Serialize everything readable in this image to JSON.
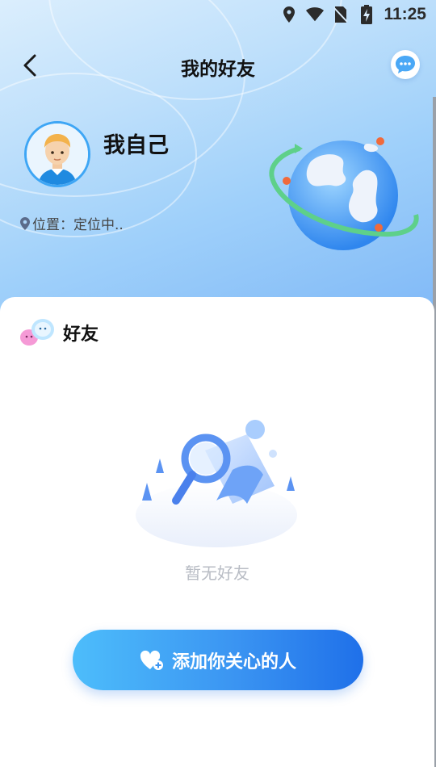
{
  "status_bar": {
    "time": "11:25",
    "icons": [
      "location-icon",
      "wifi-icon",
      "no-sim-icon",
      "battery-charging-icon"
    ]
  },
  "header": {
    "title": "我的好友",
    "back_icon": "chevron-left-icon",
    "message_icon": "chat-bubble-icon"
  },
  "profile": {
    "name": "我自己",
    "location_label": "位置：定位中.."
  },
  "friends": {
    "section_title": "好友",
    "empty_text": "暂无好友",
    "add_button_label": "添加你关心的人",
    "add_button_icon": "heart-plus-icon"
  },
  "colors": {
    "accent_blue": "#3ea6f5",
    "button_gradient_start": "#4dbdfb",
    "button_gradient_end": "#1f70e9",
    "empty_text": "#b8bcc4"
  }
}
